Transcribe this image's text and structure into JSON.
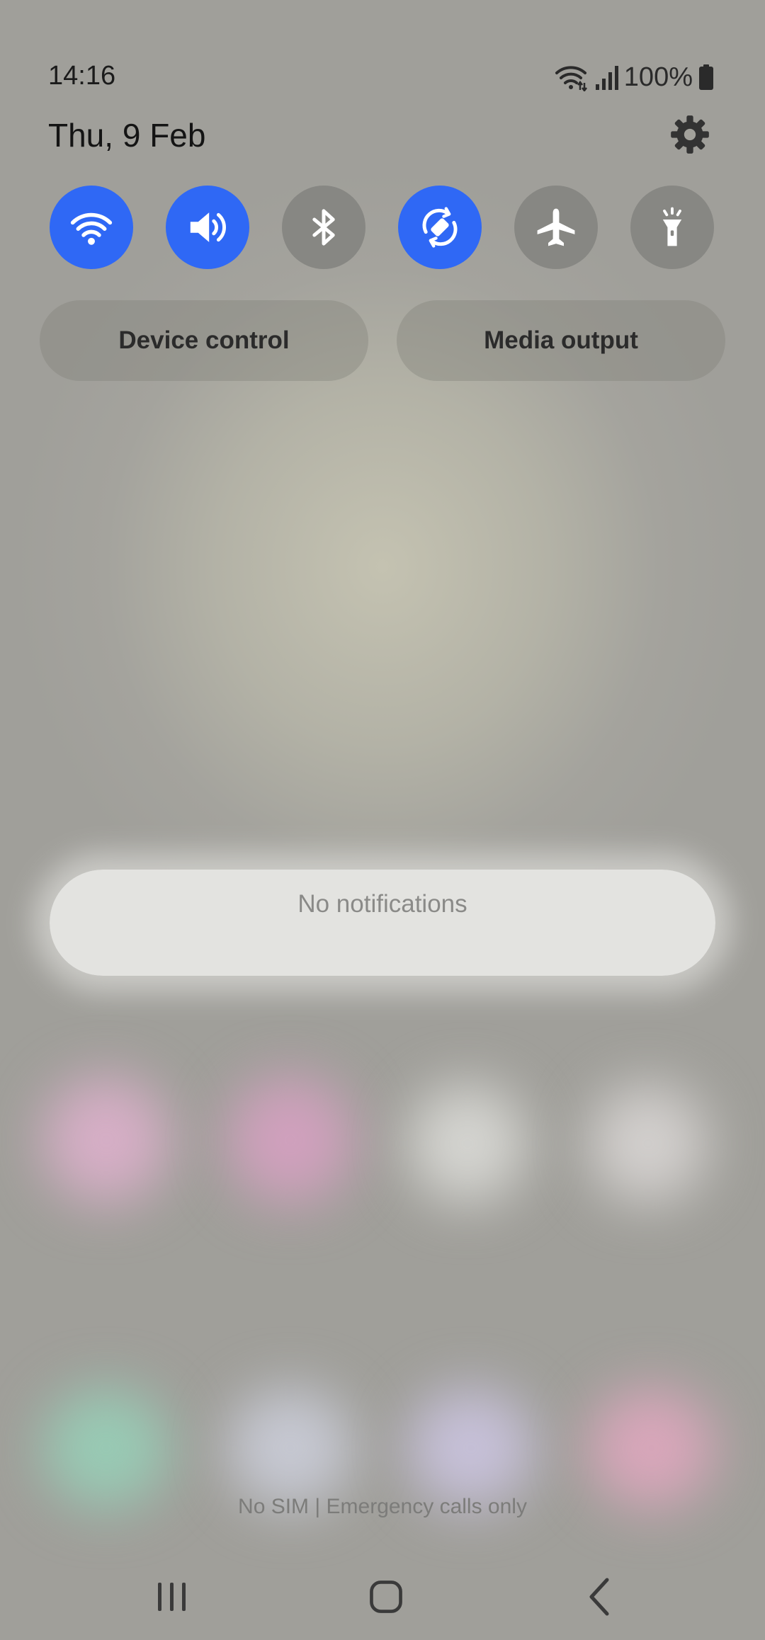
{
  "status_bar": {
    "time": "14:16",
    "battery_percent": "100%",
    "icons": [
      "wifi-data-icon",
      "signal-icon",
      "battery-icon"
    ]
  },
  "panel": {
    "date": "Thu, 9 Feb",
    "settings_icon": "gear-icon"
  },
  "quick_settings": [
    {
      "name": "wifi",
      "icon": "wifi-icon",
      "state": "on"
    },
    {
      "name": "sound",
      "icon": "volume-icon",
      "state": "on"
    },
    {
      "name": "bluetooth",
      "icon": "bluetooth-icon",
      "state": "off"
    },
    {
      "name": "auto-rotate",
      "icon": "rotate-icon",
      "state": "on"
    },
    {
      "name": "airplane-mode",
      "icon": "airplane-icon",
      "state": "off"
    },
    {
      "name": "flashlight",
      "icon": "flashlight-icon",
      "state": "off"
    }
  ],
  "buttons": {
    "device_control": "Device control",
    "media_output": "Media output"
  },
  "notifications": {
    "empty_text": "No notifications"
  },
  "carrier": {
    "text": "No SIM | Emergency calls only"
  },
  "navigation": {
    "icons": [
      "recents-icon",
      "home-icon",
      "back-icon"
    ]
  },
  "colors": {
    "tile_on": "#2f68f5",
    "tile_off": "#878783",
    "background": "#a3a29c"
  }
}
